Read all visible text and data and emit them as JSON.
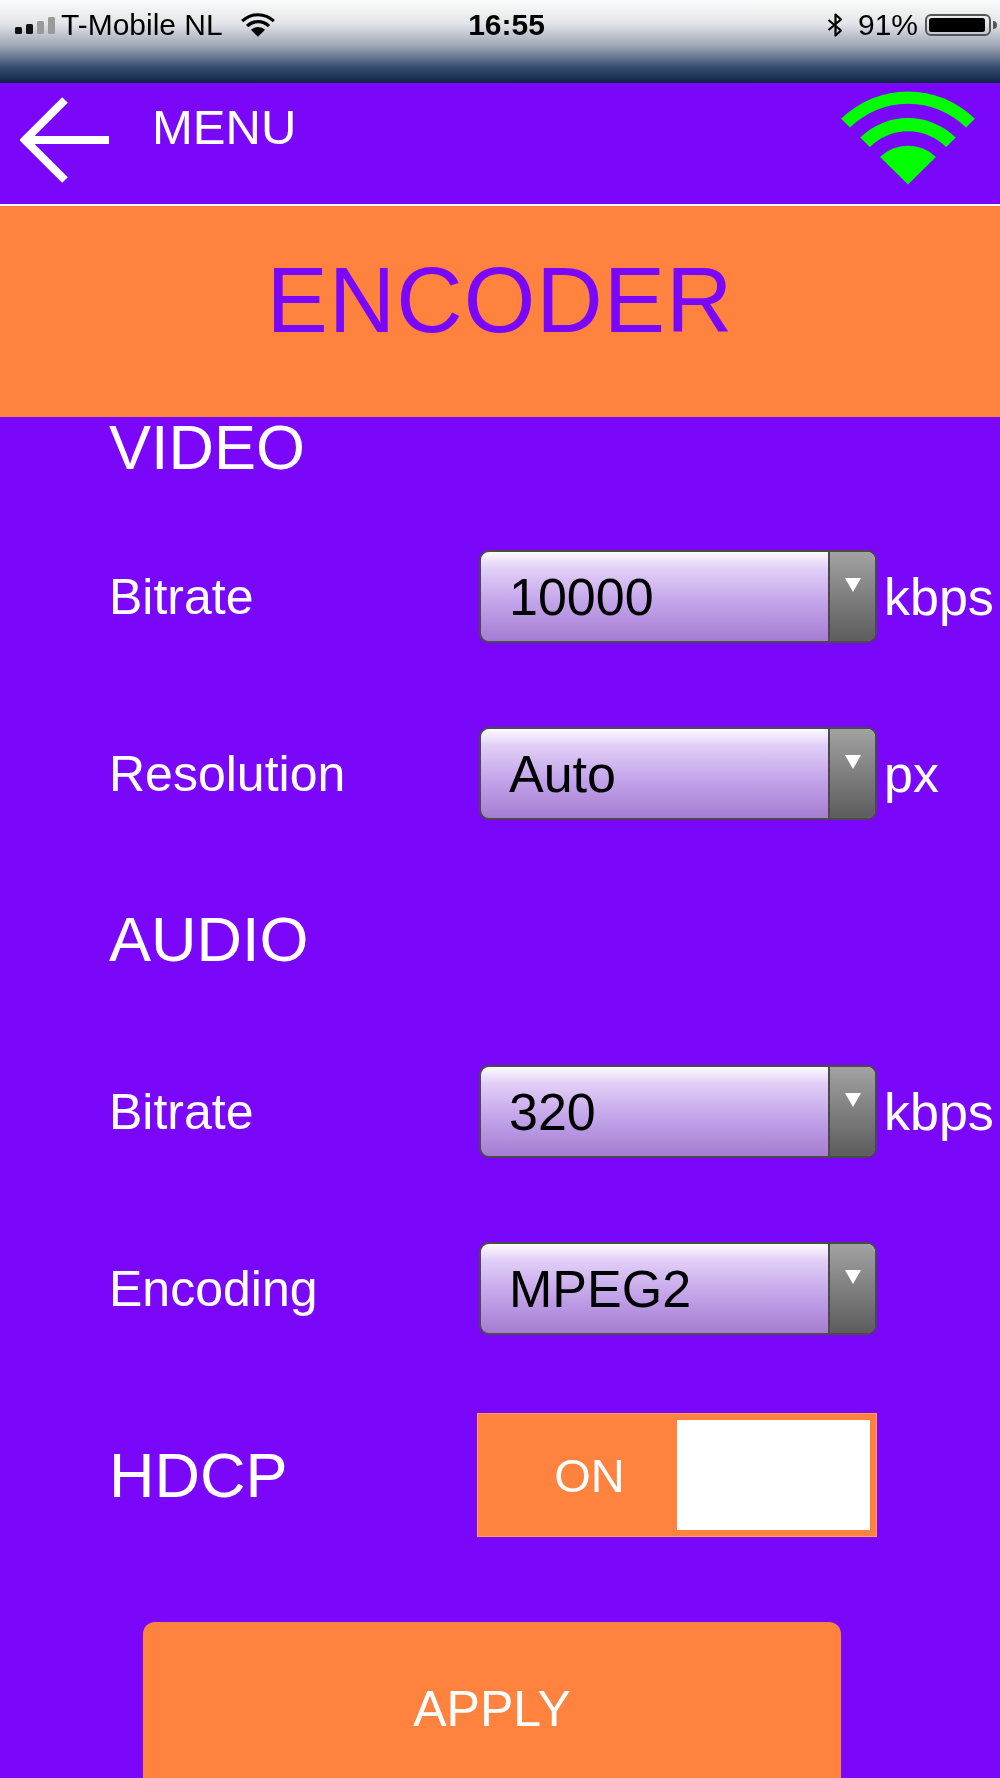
{
  "status_bar": {
    "carrier": "T-Mobile NL",
    "time": "16:55",
    "battery": "91%"
  },
  "header": {
    "title": "MENU"
  },
  "banner": {
    "title": "ENCODER"
  },
  "sections": [
    {
      "heading": "VIDEO",
      "fields": [
        {
          "kind": "dropdown",
          "label": "Bitrate",
          "value": "10000",
          "unit": "kbps"
        },
        {
          "kind": "dropdown",
          "label": "Resolution",
          "value": "Auto",
          "unit": "px"
        }
      ]
    },
    {
      "heading": "AUDIO",
      "fields": [
        {
          "kind": "dropdown",
          "label": "Bitrate",
          "value": "320",
          "unit": "kbps"
        },
        {
          "kind": "dropdown",
          "label": "Encoding",
          "value": "MPEG2"
        }
      ]
    }
  ],
  "hdcp": {
    "label": "HDCP",
    "switch_text": "ON",
    "on": true
  },
  "apply_button": {
    "label": "APPLY"
  }
}
